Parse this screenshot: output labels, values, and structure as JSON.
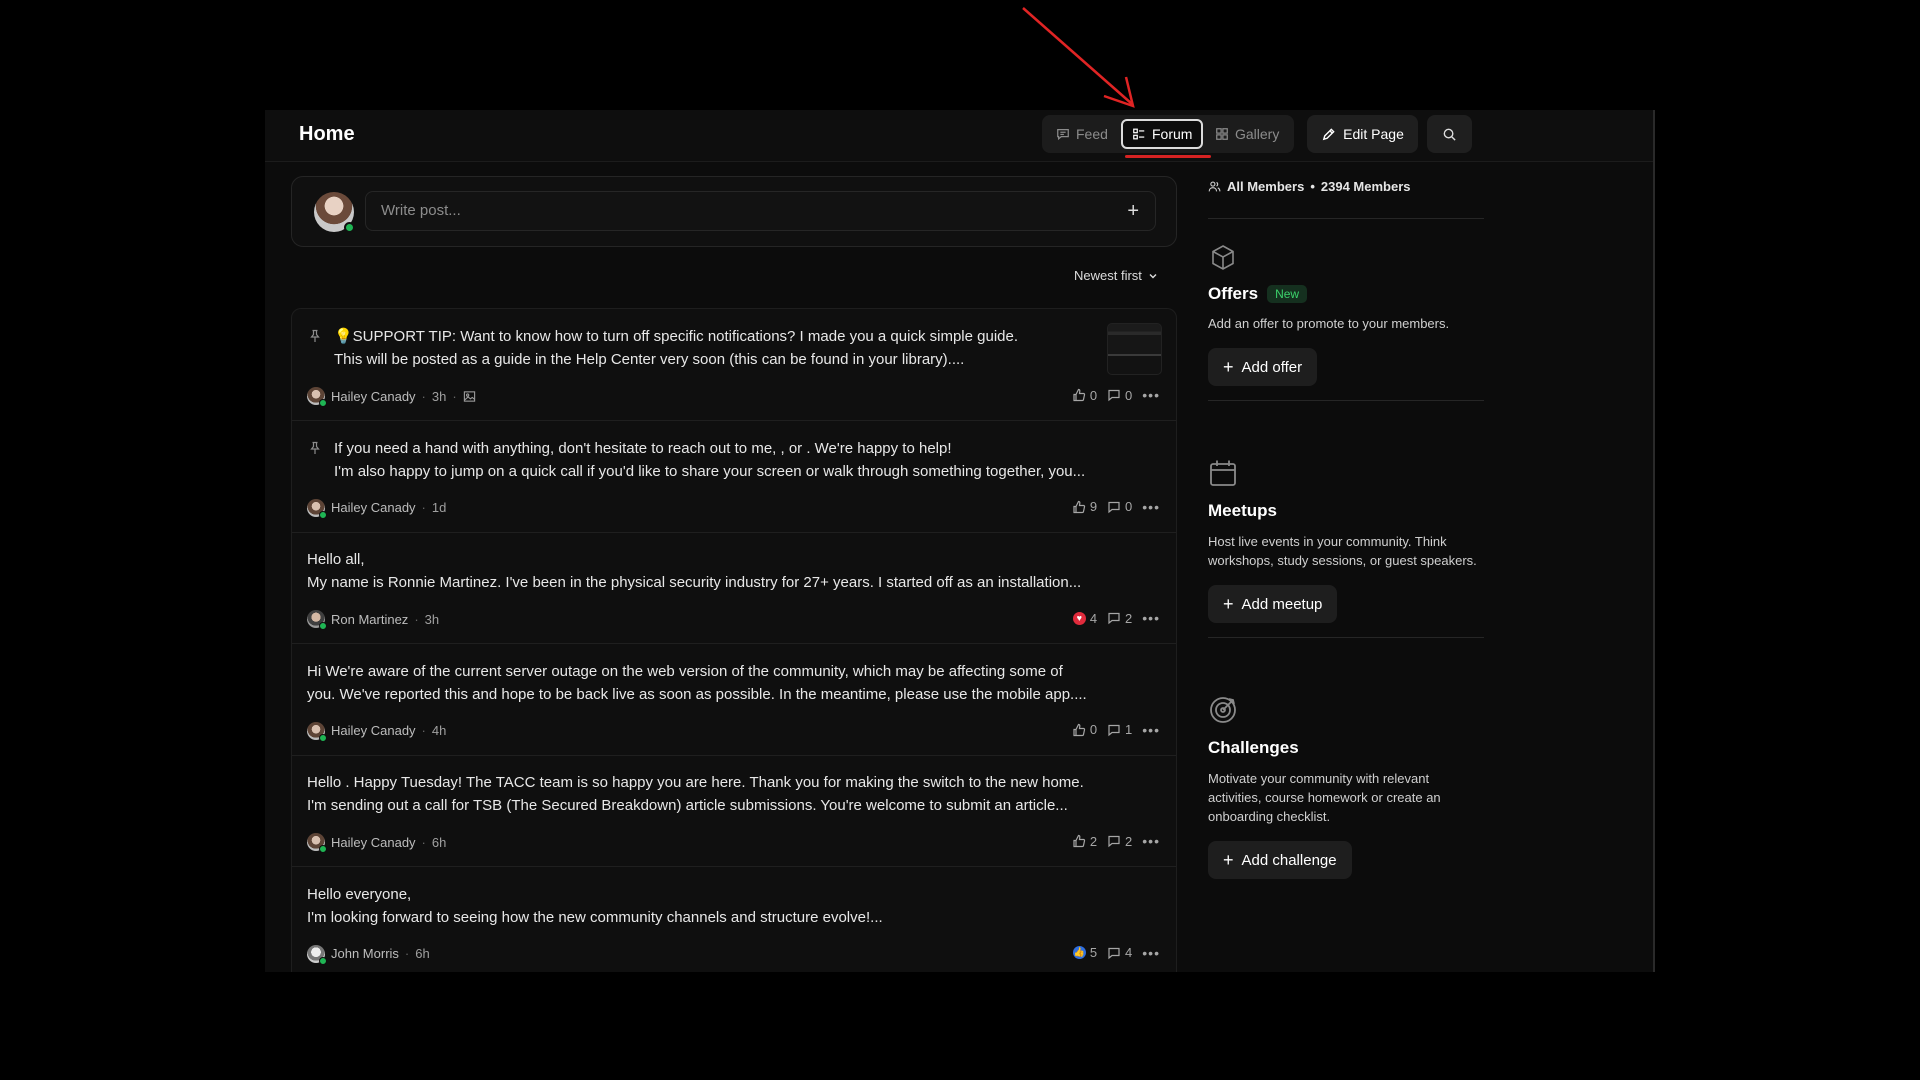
{
  "header": {
    "title": "Home",
    "views": [
      {
        "label": "Feed",
        "icon": "message-square-icon"
      },
      {
        "label": "Forum",
        "icon": "list-icon",
        "active": true
      },
      {
        "label": "Gallery",
        "icon": "grid-icon"
      }
    ],
    "edit_label": "Edit Page",
    "search_icon": "search-icon"
  },
  "composer": {
    "placeholder": "Write post...",
    "plus": "+"
  },
  "sort": {
    "label": "Newest first"
  },
  "posts": [
    {
      "pinned": true,
      "line1": "💡SUPPORT TIP: Want to know how to turn off specific notifications? I made you a quick simple guide.",
      "line2": "This will be posted as a guide in the Help Center very soon (this can be found in your library)....",
      "author": "Hailey Canady",
      "time": "3h",
      "likes": "0",
      "comments": "0",
      "has_image": true
    },
    {
      "pinned": true,
      "line1": "If you need a hand with anything, don't hesitate to reach out to me, , or . We're happy to help!",
      "line2": "I'm also happy to jump on a quick call if you'd like to share your screen or walk through something together, you...",
      "author": "Hailey Canady",
      "time": "1d",
      "likes": "9",
      "comments": "0"
    },
    {
      "pinned": false,
      "line1": "Hello all,",
      "line2": "My name is Ronnie Martinez. I've been in the physical security industry for 27+ years. I started off as an installation...",
      "author": "Ron Martinez",
      "time": "3h",
      "likes": "4",
      "comments": "2",
      "reaction": "heart"
    },
    {
      "pinned": false,
      "line1": "Hi We're aware of the current server outage on the web version of the community, which may be affecting some of",
      "line2": "you. We've reported this and hope to be back live as soon as possible. In the meantime, please use the mobile app....",
      "author": "Hailey Canady",
      "time": "4h",
      "likes": "0",
      "comments": "1"
    },
    {
      "pinned": false,
      "line1": "Hello . Happy Tuesday! The TACC team is so happy you are here. Thank you for making the switch to the new home.",
      "line2": "I'm sending out a call for TSB (The Secured Breakdown) article submissions. You're welcome to submit an article...",
      "author": "Hailey Canady",
      "time": "6h",
      "likes": "2",
      "comments": "2"
    },
    {
      "pinned": false,
      "line1": "Hello everyone,",
      "line2": "I'm looking forward to seeing how the new community channels and structure evolve!...",
      "author": "John Morris",
      "time": "6h",
      "likes": "5",
      "comments": "4",
      "reaction": "like"
    }
  ],
  "sidebar": {
    "members_label": "All Members",
    "members_count": "2394 Members",
    "offers": {
      "title": "Offers",
      "badge": "New",
      "desc": "Add an offer to promote to your members.",
      "button": "Add offer"
    },
    "meetups": {
      "title": "Meetups",
      "desc": "Host live events in your community. Think workshops, study sessions, or guest speakers.",
      "button": "Add meetup"
    },
    "challenges": {
      "title": "Challenges",
      "desc": "Motivate your community with relevant activities, course homework or create an onboarding checklist.",
      "button": "Add challenge"
    }
  },
  "colors": {
    "accent_annotation": "#d52222",
    "online": "#1fb554",
    "new_badge": "#3bd26b"
  }
}
